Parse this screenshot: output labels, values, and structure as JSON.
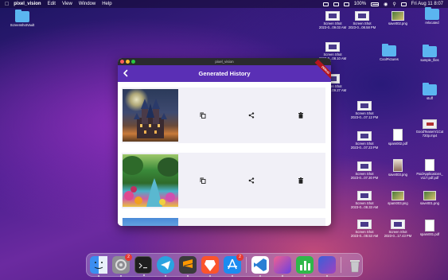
{
  "menubar": {
    "app_name": "pixel_vision",
    "items": [
      "Edit",
      "View",
      "Window",
      "Help"
    ],
    "battery": "100%",
    "clock": "Fri Aug 11  8:07"
  },
  "desktop": {
    "icons": [
      {
        "label": "ScreenshotVault",
        "kind": "folder"
      },
      {
        "label": "Screen Shot\n2023-0...09.03 AM",
        "kind": "screenshot"
      },
      {
        "label": "Screen Shot\n2023-0...08.58 PM",
        "kind": "screenshot"
      },
      {
        "label": "save002.png",
        "kind": "image"
      },
      {
        "label": "relocated",
        "kind": "folder"
      },
      {
        "label": "Screen Shot\n2023-0...08.10 AM",
        "kind": "screenshot"
      },
      {
        "label": "CoolPictures",
        "kind": "folder"
      },
      {
        "label": "sample_files",
        "kind": "folder"
      },
      {
        "label": "Screen Shot\n2023-0...09.27 AM",
        "kind": "screenshot"
      },
      {
        "label": "stuff",
        "kind": "folder"
      },
      {
        "label": "Screen Shot\n2023-0...07.12 PM",
        "kind": "screenshot"
      },
      {
        "label": "Screen Shot\n2023-0...07.23 PM",
        "kind": "screenshot"
      },
      {
        "label": "spam002.pdf",
        "kind": "document"
      },
      {
        "label": "GoodTeaserV1Cut\n720p.mp4",
        "kind": "video"
      },
      {
        "label": "Screen Shot\n2023-0...07.30 PM",
        "kind": "screenshot"
      },
      {
        "label": "save003.png",
        "kind": "portrait"
      },
      {
        "label": "PaidApplications_\nv117.pdf.pdf",
        "kind": "document"
      },
      {
        "label": "Screen Shot\n2023-0...08.33 AM",
        "kind": "screenshot"
      },
      {
        "label": "spam003.png",
        "kind": "image"
      },
      {
        "label": "save001.png",
        "kind": "image"
      },
      {
        "label": "Screen Shot\n2023-0...08.53 AM",
        "kind": "screenshot"
      },
      {
        "label": "Screen Shot\n2023-0...17.43 PM",
        "kind": "screenshot"
      },
      {
        "label": "spam001.pdf",
        "kind": "document"
      }
    ]
  },
  "window": {
    "title": "pixel_vision",
    "heading": "Generated History",
    "debug_banner": "DEBUG",
    "items": [
      {
        "thumb": "castle-image",
        "actions": [
          "copy-icon",
          "share-icon",
          "delete-icon"
        ]
      },
      {
        "thumb": "garden-image",
        "actions": [
          "copy-icon",
          "share-icon",
          "delete-icon"
        ]
      }
    ]
  },
  "dock": {
    "apps": [
      {
        "name": "finder",
        "color": "#3b8ef0"
      },
      {
        "name": "system-settings",
        "color": "#8e8e93",
        "badge": "2"
      },
      {
        "name": "terminal",
        "color": "#1e1e1e"
      },
      {
        "name": "telegram",
        "color": "#2aa3e0"
      },
      {
        "name": "sublime-text",
        "color": "#ff9800"
      },
      {
        "name": "brave",
        "color": "#fb542b"
      },
      {
        "name": "app-store",
        "color": "#1c8cf0",
        "badge": "2"
      },
      {
        "name": "vscode",
        "color": "#2a7fd4"
      },
      {
        "name": "arc",
        "color": "#e85a9a"
      },
      {
        "name": "numbers",
        "color": "#2fb84a"
      },
      {
        "name": "pixel-vision",
        "color": "#4a6ad8"
      },
      {
        "name": "trash",
        "color": "#c8c8cc"
      }
    ]
  }
}
